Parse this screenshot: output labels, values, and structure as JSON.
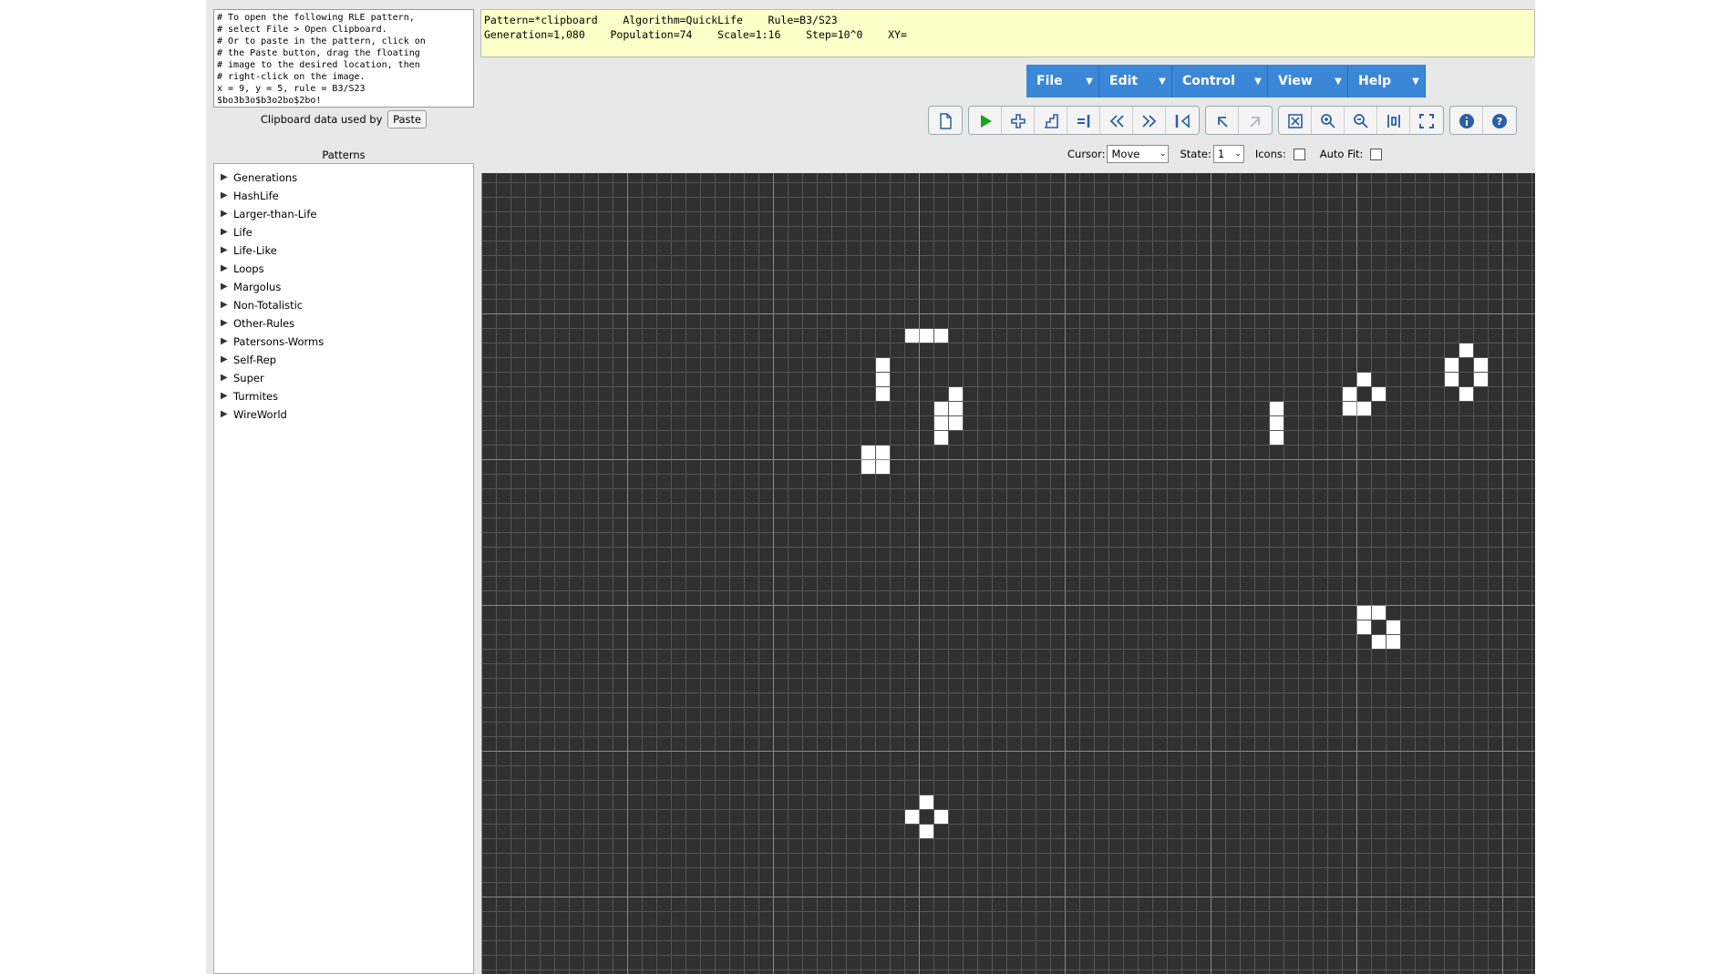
{
  "clipboard": {
    "text": "# To open the following RLE pattern,\n# select File > Open Clipboard.\n# Or to paste in the pattern, click on\n# the Paste button, drag the floating\n# image to the desired location, then\n# right-click on the image.\nx = 9, y = 5, rule = B3/S23\n$bo3b3o$b3o2bo$2bo!",
    "used_by_label": "Clipboard data used by",
    "paste_button": "Paste"
  },
  "patterns": {
    "title": "Patterns",
    "folders": [
      "Generations",
      "HashLife",
      "Larger-than-Life",
      "Life",
      "Life-Like",
      "Loops",
      "Margolus",
      "Non-Totalistic",
      "Other-Rules",
      "Patersons-Worms",
      "Self-Rep",
      "Super",
      "Turmites",
      "WireWorld"
    ]
  },
  "status": {
    "line1": "Pattern=*clipboard    Algorithm=QuickLife    Rule=B3/S23",
    "line2": "Generation=1,080    Population=74    Scale=1:16    Step=10^0    XY="
  },
  "menus": [
    {
      "label": "File"
    },
    {
      "label": "Edit"
    },
    {
      "label": "Control"
    },
    {
      "label": "View"
    },
    {
      "label": "Help"
    }
  ],
  "toolbar": {
    "groups": [
      [
        "new-pattern-icon"
      ],
      [
        "play-icon",
        "step-plus-icon",
        "step-icon",
        "step-to-end-icon",
        "slower-icon",
        "faster-icon",
        "reset-icon"
      ],
      [
        "undo-icon",
        "redo-icon"
      ],
      [
        "fit-icon",
        "zoom-in-icon",
        "zoom-out-icon",
        "middle-icon",
        "full-screen-icon"
      ],
      [
        "info-icon",
        "help-icon"
      ]
    ]
  },
  "controls": {
    "cursor_label": "Cursor:",
    "cursor_value": "Move",
    "state_label": "State:",
    "state_value": "1",
    "icons_label": "Icons:",
    "icons_checked": false,
    "autofit_label": "Auto Fit:",
    "autofit_checked": false
  },
  "grid": {
    "cell_size": 16,
    "live_cells": [
      [
        29,
        11
      ],
      [
        30,
        11
      ],
      [
        31,
        11
      ],
      [
        27,
        13
      ],
      [
        27,
        14
      ],
      [
        27,
        15
      ],
      [
        32,
        15
      ],
      [
        31,
        16
      ],
      [
        32,
        16
      ],
      [
        31,
        17
      ],
      [
        32,
        17
      ],
      [
        31,
        18
      ],
      [
        26,
        19
      ],
      [
        27,
        19
      ],
      [
        26,
        20
      ],
      [
        27,
        20
      ],
      [
        54,
        16
      ],
      [
        54,
        17
      ],
      [
        54,
        18
      ],
      [
        60,
        14
      ],
      [
        59,
        15
      ],
      [
        61,
        15
      ],
      [
        59,
        16
      ],
      [
        60,
        16
      ],
      [
        67,
        12
      ],
      [
        66,
        13
      ],
      [
        68,
        13
      ],
      [
        66,
        14
      ],
      [
        68,
        14
      ],
      [
        67,
        15
      ],
      [
        60,
        30
      ],
      [
        61,
        30
      ],
      [
        60,
        31
      ],
      [
        62,
        31
      ],
      [
        61,
        32
      ],
      [
        62,
        32
      ],
      [
        30,
        43
      ],
      [
        29,
        44
      ],
      [
        31,
        44
      ],
      [
        30,
        45
      ]
    ]
  }
}
